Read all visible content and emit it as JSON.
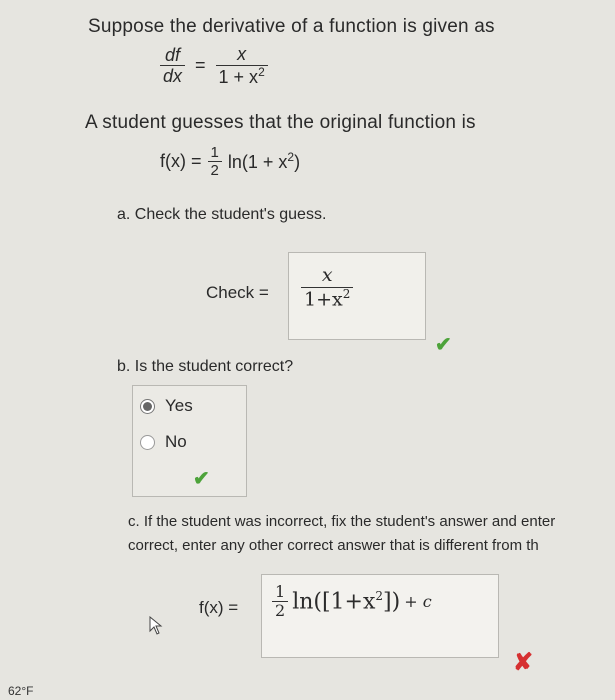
{
  "intro": "Suppose the derivative of a function is given as",
  "eq1": {
    "num_left": "df",
    "den_left": "dx",
    "eq": "=",
    "num_right": "x",
    "den_right_a": "1 + x",
    "den_right_sup": "2"
  },
  "guess_text": "A student guesses that the original function is",
  "eq2": {
    "lhs": "f(x) =",
    "num": "1",
    "den": "2",
    "rhs_a": "ln(1 + x",
    "rhs_sup": "2",
    "rhs_b": ")"
  },
  "part_a": {
    "question": "a. Check the student's guess.",
    "check_label": "Check =",
    "num": "x",
    "den_a": "1+x",
    "den_sup": "2",
    "status": "✔"
  },
  "part_b": {
    "question": "b. Is the student correct?",
    "options": [
      "Yes",
      "No"
    ],
    "selected": "Yes",
    "status": "✔"
  },
  "part_c": {
    "line1": "c. If the student was incorrect, fix the student's answer and enter",
    "line2": "correct, enter any other correct answer that is different from th",
    "label": "f(x) =",
    "num": "1",
    "den": "2",
    "expr_a": "ln([1+x",
    "expr_sup": "2",
    "expr_b": "])",
    "expr_c": "+ c",
    "status": "✘"
  },
  "taskbar": {
    "temperature": "62°F"
  },
  "colors": {
    "correct": "#4da33a",
    "incorrect": "#d63031",
    "background": "#e6e5e0"
  }
}
